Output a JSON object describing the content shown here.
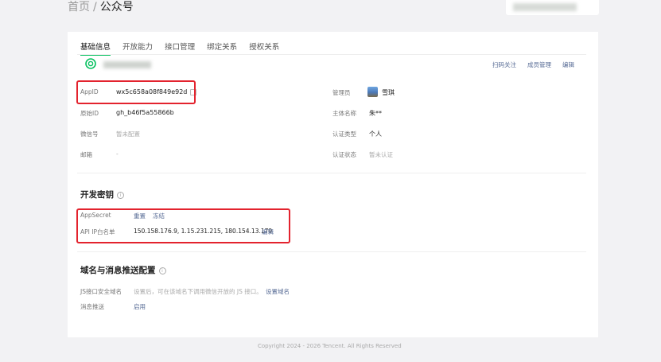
{
  "breadcrumb": {
    "home": "首页",
    "separator": "/",
    "current": "公众号"
  },
  "tabs": [
    "基础信息",
    "开放能力",
    "接口管理",
    "绑定关系",
    "授权关系"
  ],
  "account_actions": {
    "scan_follow": "扫码关注",
    "member_manage": "成员管理",
    "edit": "编辑"
  },
  "basic_info": {
    "appid_label": "AppID",
    "appid_value": "wx5c658a08f849e92d",
    "original_id_label": "原始ID",
    "original_id_value": "gh_b46f5a55866b",
    "wechat_id_label": "微信号",
    "wechat_id_value": "暂未配置",
    "email_label": "邮箱",
    "email_value": "-",
    "admin_label": "管理员",
    "admin_value": "雪琪",
    "subject_label": "主体名称",
    "subject_value": "朱**",
    "cert_type_label": "认证类型",
    "cert_type_value": "个人",
    "cert_status_label": "认证状态",
    "cert_status_value": "暂未认证"
  },
  "dev_key": {
    "title": "开发密钥",
    "info_icon": "i",
    "appsecret_label": "AppSecret",
    "reset": "重置",
    "freeze": "冻结",
    "ip_whitelist_label": "API IP白名单",
    "ip_whitelist_value": "150.158.176.9, 1.15.231.215, 180.154.13.179",
    "ip_edit": "编辑"
  },
  "domain_push": {
    "title": "域名与消息推送配置",
    "info_icon": "i",
    "js_domain_label": "JS接口安全域名",
    "js_domain_desc": "设置后，可在该域名下调用微信开放的 JS 接口。",
    "js_domain_link": "设置域名",
    "msg_push_label": "消息推送",
    "msg_push_link": "启用"
  },
  "footer": "Copyright 2024 - 2026 Tencent. All Rights Reserved",
  "colors": {
    "accent": "#07c160",
    "link": "#576b95",
    "highlight": "#e3232e"
  }
}
